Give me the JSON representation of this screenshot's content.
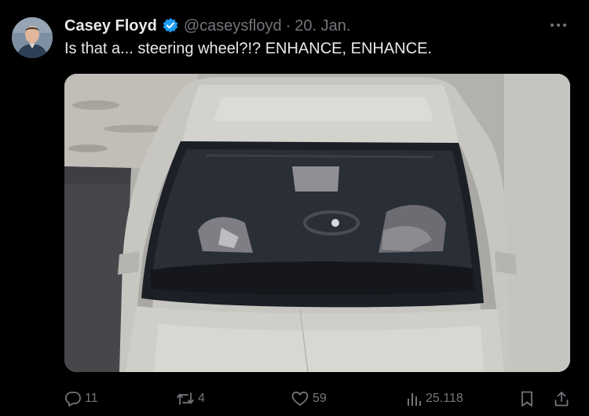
{
  "tweet": {
    "author_name": "Casey Floyd",
    "handle": "@caseysfloyd",
    "separator": "·",
    "date": "20. Jan.",
    "text": "Is that a... steering wheel?!? ENHANCE, ENHANCE.",
    "verified": true
  },
  "media": {
    "subject": "car-windshield-photo"
  },
  "actions": {
    "reply_count": "11",
    "retweet_count": "4",
    "like_count": "59",
    "view_count": "25.118"
  },
  "icons": {
    "more": "more-horizontal-icon",
    "reply": "reply-icon",
    "retweet": "retweet-icon",
    "like": "heart-icon",
    "views": "views-chart-icon",
    "bookmark": "bookmark-icon",
    "share": "share-icon",
    "verified": "verified-badge-icon"
  },
  "colors": {
    "background": "#000000",
    "primary_text": "#e7e9ea",
    "secondary_text": "#71767b",
    "verified_blue": "#1d9bf0"
  }
}
